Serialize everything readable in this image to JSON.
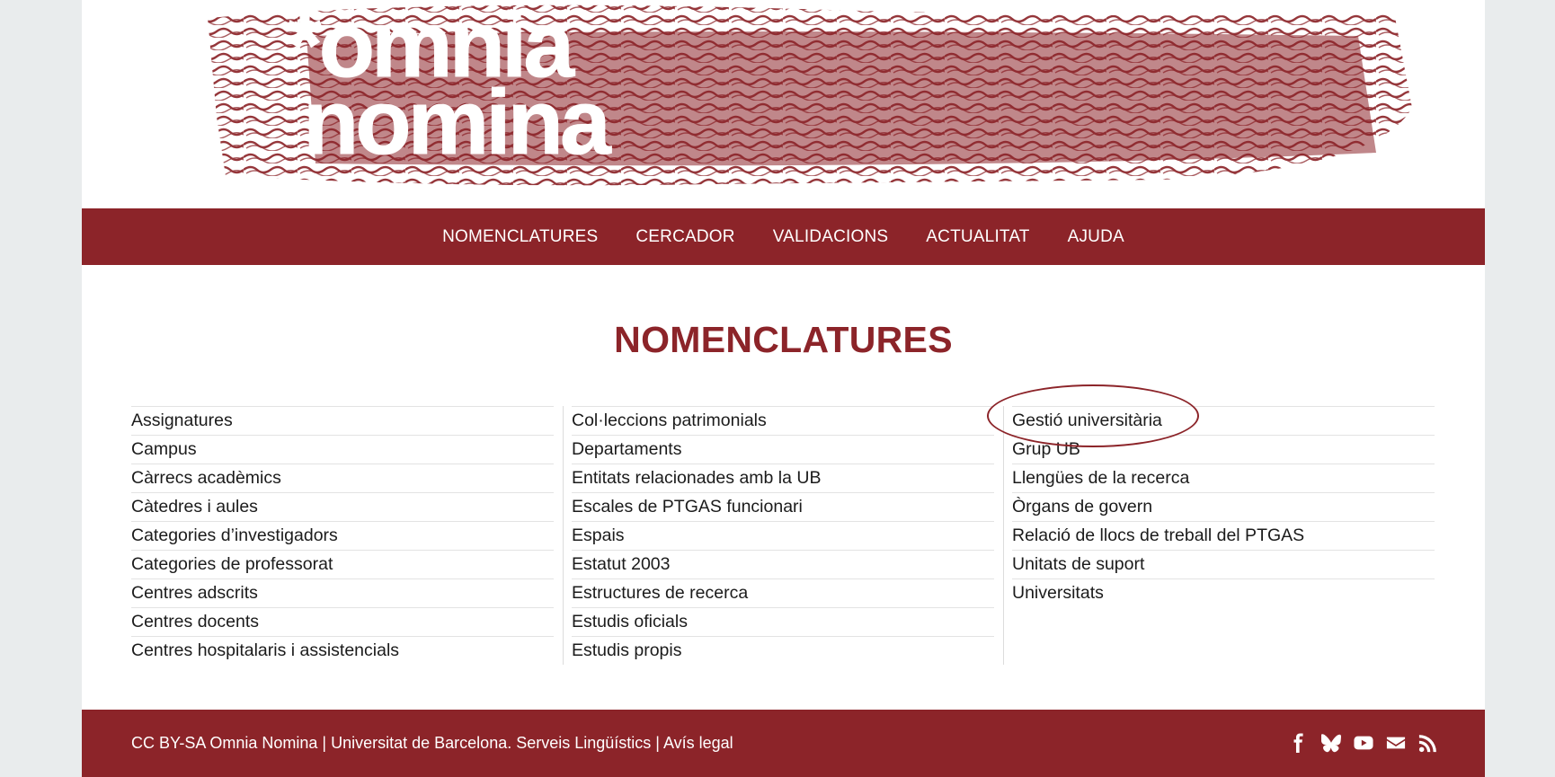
{
  "header": {
    "logo_line1": "*omnia",
    "logo_line2": "nomina"
  },
  "nav": {
    "items": [
      "NOMENCLATURES",
      "CERCADOR",
      "VALIDACIONS",
      "ACTUALITAT",
      "AJUDA"
    ]
  },
  "main": {
    "title": "NOMENCLATURES",
    "columns": [
      [
        "Assignatures",
        "Campus",
        "Càrrecs acadèmics",
        "Càtedres i aules",
        "Categories d’investigadors",
        "Categories de professorat",
        "Centres adscrits",
        "Centres docents",
        "Centres hospitalaris i assistencials"
      ],
      [
        "Col·leccions patrimonials",
        "Departaments",
        "Entitats relacionades amb la UB",
        "Escales de PTGAS funcionari",
        "Espais",
        "Estatut 2003",
        "Estructures de recerca",
        "Estudis oficials",
        "Estudis propis"
      ],
      [
        "Gestió universitària",
        "Grup UB",
        "Llengües de la recerca",
        "Òrgans de govern",
        "Relació de llocs de treball del PTGAS",
        "Unitats de suport",
        "Universitats"
      ]
    ]
  },
  "footer": {
    "license": "CC BY-SA Omnia Nomina",
    "sep1": " | ",
    "org": "Universitat de Barcelona. Serveis Lingüístics",
    "sep2": " | ",
    "legal": "Avís legal",
    "social": [
      "facebook-icon",
      "bluesky-icon",
      "youtube-icon",
      "email-icon",
      "rss-icon"
    ]
  },
  "colors": {
    "brand": "#8c2429",
    "background": "#e9eced"
  }
}
